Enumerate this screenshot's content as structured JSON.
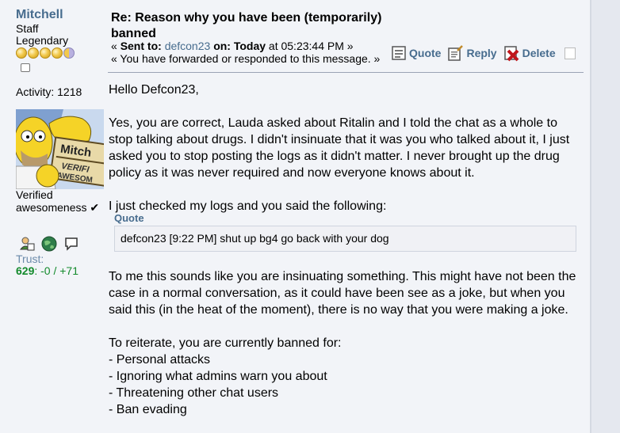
{
  "author": {
    "name": "Mitchell",
    "position": "Staff",
    "rank": "Legendary",
    "activity": "Activity: 1218",
    "personal_text": "Verified awesomeness ✔",
    "trust_label": "Trust:",
    "trust_total": "629",
    "trust_separator": ": ",
    "trust_breakdown": "-0 / +71",
    "avatar_text": [
      "Mitch",
      "VERIFI",
      "AWESOM"
    ]
  },
  "post": {
    "title": "Re: Reason why you have been (temporarily) banned",
    "meta_line1": {
      "prefix": "« ",
      "sent_to_label": "Sent to:",
      "recipient": "defcon23",
      "on_label": "on: Today",
      "time": " at 05:23:44 PM »"
    },
    "meta_line2": "« You have forwarded or responded to this message. »",
    "actions": {
      "quote": "Quote",
      "reply": "Reply",
      "delete": "Delete"
    },
    "body": {
      "greeting": "Hello Defcon23,",
      "para1": "Yes, you are correct, Lauda asked about Ritalin and I told the chat as a whole to stop talking about drugs. I didn't insinuate that it was you who talked about it, I just asked you to stop posting the logs as it didn't matter. I never brought up the drug policy as it was never required and now everyone knows about it.",
      "para2": "I just checked my logs and you said the following:",
      "quote_header": "Quote",
      "quote_text": "defcon23 [9:22 PM] shut up bg4 go back with your dog",
      "para3": "To me this sounds like you are insinuating something. This might have not been the case in a normal conversation, as it could have been see as a joke, but when you said this (in the heat of the moment), there is no way that you were making a joke.",
      "para4": "To reiterate, you are currently banned for:",
      "list": [
        "- Personal attacks",
        "- Ignoring what admins warn you about",
        "- Threatening other chat users",
        "- Ban evading"
      ]
    }
  },
  "colors": {
    "link": "#476c8e",
    "trust_positive": "#138a2c",
    "panel": "#f2f4f8",
    "background": "#e5e8ef"
  }
}
